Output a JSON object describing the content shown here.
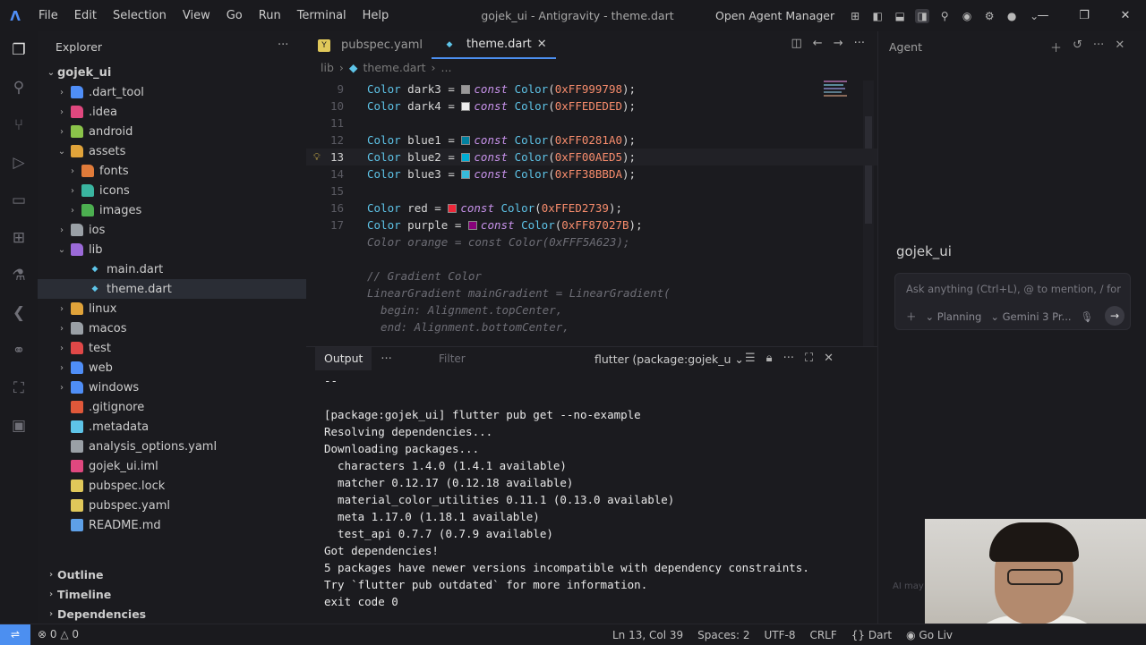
{
  "titlebar": {
    "menu": [
      "File",
      "Edit",
      "Selection",
      "View",
      "Go",
      "Run",
      "Terminal",
      "Help"
    ],
    "window_title": "gojek_ui - Antigravity - theme.dart",
    "agent_manager": "Open Agent Manager"
  },
  "explorer": {
    "header": "Explorer",
    "root": "gojek_ui",
    "items": [
      {
        "label": ".dart_tool",
        "depth": 1,
        "type": "folder",
        "icon_color": "#4f8ef7"
      },
      {
        "label": ".idea",
        "depth": 1,
        "type": "folder",
        "icon_color": "#e0487f"
      },
      {
        "label": "android",
        "depth": 1,
        "type": "folder",
        "icon_color": "#8bc34a"
      },
      {
        "label": "assets",
        "depth": 1,
        "type": "folder-open",
        "icon_color": "#e0a33a"
      },
      {
        "label": "fonts",
        "depth": 2,
        "type": "folder",
        "icon_color": "#e07b3a"
      },
      {
        "label": "icons",
        "depth": 2,
        "type": "folder",
        "icon_color": "#3ab5a0"
      },
      {
        "label": "images",
        "depth": 2,
        "type": "folder",
        "icon_color": "#4caf50"
      },
      {
        "label": "ios",
        "depth": 1,
        "type": "folder",
        "icon_color": "#9aa0a6"
      },
      {
        "label": "lib",
        "depth": 1,
        "type": "folder-open",
        "icon_color": "#9b6ad8"
      },
      {
        "label": "main.dart",
        "depth": 2,
        "type": "dart",
        "icon_color": "#5ec4e8"
      },
      {
        "label": "theme.dart",
        "depth": 2,
        "type": "dart",
        "icon_color": "#5ec4e8"
      },
      {
        "label": "linux",
        "depth": 1,
        "type": "folder",
        "icon_color": "#e0a33a"
      },
      {
        "label": "macos",
        "depth": 1,
        "type": "folder",
        "icon_color": "#9aa0a6"
      },
      {
        "label": "test",
        "depth": 1,
        "type": "folder",
        "icon_color": "#e04848"
      },
      {
        "label": "web",
        "depth": 1,
        "type": "folder",
        "icon_color": "#4f8ef7"
      },
      {
        "label": "windows",
        "depth": 1,
        "type": "folder",
        "icon_color": "#4f8ef7"
      },
      {
        "label": ".gitignore",
        "depth": 1,
        "type": "file",
        "icon_color": "#e0583a"
      },
      {
        "label": ".metadata",
        "depth": 1,
        "type": "file",
        "icon_color": "#5ec4e8"
      },
      {
        "label": "analysis_options.yaml",
        "depth": 1,
        "type": "file",
        "icon_color": "#9aa0a6"
      },
      {
        "label": "gojek_ui.iml",
        "depth": 1,
        "type": "file",
        "icon_color": "#e0487f"
      },
      {
        "label": "pubspec.lock",
        "depth": 1,
        "type": "file",
        "icon_color": "#e0c85a"
      },
      {
        "label": "pubspec.yaml",
        "depth": 1,
        "type": "file",
        "icon_color": "#e0c85a"
      },
      {
        "label": "README.md",
        "depth": 1,
        "type": "file",
        "icon_color": "#5ea0e8"
      }
    ],
    "sections": [
      "Outline",
      "Timeline",
      "Dependencies"
    ]
  },
  "editor": {
    "tabs": [
      {
        "label": "pubspec.yaml",
        "active": false
      },
      {
        "label": "theme.dart",
        "active": true
      }
    ],
    "breadcrumb": [
      "lib",
      "theme.dart",
      "..."
    ],
    "lines": [
      {
        "num": "9",
        "name": "dark3",
        "value": "0xFF999798",
        "swatch": "#999798"
      },
      {
        "num": "10",
        "name": "dark4",
        "value": "0xFFEDEDED",
        "swatch": "#EDEDED"
      },
      {
        "num": "11"
      },
      {
        "num": "12",
        "name": "blue1",
        "value": "0xFF0281A0",
        "swatch": "#0281A0"
      },
      {
        "num": "13",
        "name": "blue2",
        "value": "0xFF00AED5",
        "swatch": "#00AED5"
      },
      {
        "num": "14",
        "name": "blue3",
        "value": "0xFF38BBDA",
        "swatch": "#38BBDA"
      },
      {
        "num": "15"
      },
      {
        "num": "16",
        "name": "red",
        "value": "0xFFED2739",
        "swatch": "#ED2739"
      },
      {
        "num": "17",
        "name": "purple",
        "value": "0xFF87027B",
        "swatch": "#87027B"
      }
    ],
    "ghost_lines": [
      "Color orange = const Color(0xFFF5A623);",
      "",
      "// Gradient Color",
      "LinearGradient mainGradient = LinearGradient(",
      "  begin: Alignment.topCenter,",
      "  end: Alignment.bottomCenter,"
    ],
    "tokens": {
      "type": "Color",
      "kw": "const",
      "eq": "=",
      "semi": ";"
    }
  },
  "panel": {
    "tab": "Output",
    "filter_placeholder": "Filter",
    "channel": "flutter (package:gojek_u",
    "output": [
      "--",
      "",
      "[package:gojek_ui] flutter pub get --no-example",
      "Resolving dependencies...",
      "Downloading packages...",
      "  characters 1.4.0 (1.4.1 available)",
      "  matcher 0.12.17 (0.12.18 available)",
      "  material_color_utilities 0.11.1 (0.13.0 available)",
      "  meta 1.17.0 (1.18.1 available)",
      "  test_api 0.7.7 (0.7.9 available)",
      "Got dependencies!",
      "5 packages have newer versions incompatible with dependency constraints.",
      "Try `flutter pub outdated` for more information.",
      "exit code 0"
    ]
  },
  "agent": {
    "title": "Agent",
    "project": "gojek_ui",
    "input_placeholder": "Ask anything (Ctrl+L), @ to mention, / for wo",
    "mode": "Planning",
    "model": "Gemini 3 Pr...",
    "disclaimer": "AI may"
  },
  "statusbar": {
    "problems": "0",
    "warnings": "0",
    "position": "Ln 13, Col 39",
    "spaces": "Spaces: 2",
    "encoding": "UTF-8",
    "eol": "CRLF",
    "language": "Dart",
    "golive": "Go Liv"
  }
}
